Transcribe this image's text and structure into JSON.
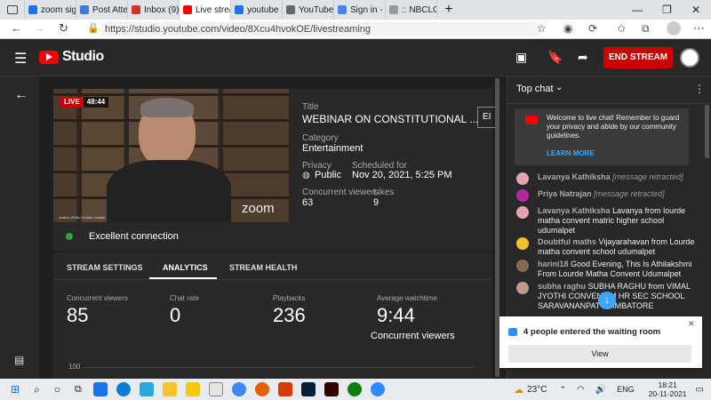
{
  "browser": {
    "tabs": [
      {
        "label": "zoom sign",
        "color": "#1a73e8"
      },
      {
        "label": "Post Attend",
        "color": "#3b7ddd"
      },
      {
        "label": "Inbox (9) -",
        "color": "#d93025"
      },
      {
        "label": "Live stream",
        "color": "#ff0000"
      },
      {
        "label": "youtube stu",
        "color": "#1a73e8"
      },
      {
        "label": "YouTube St",
        "color": "#666666"
      },
      {
        "label": "Sign in - Go",
        "color": "#4285f4"
      },
      {
        "label": ":: NBCLC ::",
        "color": "#999999"
      }
    ],
    "url": "https://studio.youtube.com/video/8Xcu4hvokOE/livestreaming"
  },
  "header": {
    "brand": "Studio",
    "end_stream": "END STREAM"
  },
  "stream": {
    "live_badge": "LIVE",
    "elapsed": "48:44",
    "zoom_watermark": "zoom",
    "caption": "Justice (Retd.) Kurian Joseph",
    "title_label": "Title",
    "title": "WEBINAR ON CONSTITUTIONAL ...",
    "edit_label": "EI",
    "category_label": "Category",
    "category": "Entertainment",
    "privacy_label": "Privacy",
    "privacy": "Public",
    "scheduled_label": "Scheduled for",
    "scheduled": "Nov 20, 2021, 5:25 PM",
    "concurrent_label": "Concurrent viewers",
    "concurrent": "63",
    "likes_label": "Likes",
    "likes": "9",
    "connection": "Excellent connection"
  },
  "tabs": {
    "settings": "STREAM SETTINGS",
    "analytics": "ANALYTICS",
    "health": "STREAM HEALTH"
  },
  "analytics": {
    "m1_label": "Concurrent viewers",
    "m1": "85",
    "m2_label": "Chat rate",
    "m2": "0",
    "m3_label": "Playbacks",
    "m3": "236",
    "m4_label": "Average watchtime",
    "m4": "9:44",
    "chart_title": "Concurrent viewers",
    "axis_top": "100"
  },
  "chat": {
    "title": "Top chat",
    "welcome": "Welcome to live chat! Remember to guard your privacy and abide by our community guidelines.",
    "learn_more": "LEARN MORE",
    "messages": [
      {
        "name": "Lavanya Kathiksha",
        "text": "[message retracted]",
        "color": "#e3a3b3"
      },
      {
        "name": "Priya Natrajan",
        "text": "[message retracted]",
        "color": "#b0279f"
      },
      {
        "name": "Lavanya Kathiksha",
        "text": "Lavanya from lourde matha convent matric higher school udumalpet",
        "color": "#e3a3b3"
      },
      {
        "name": "Doubtful maths",
        "text": "Vijayarahavan from Lourde matha convent school udumalpet",
        "color": "#f0c22e"
      },
      {
        "name": "harini18",
        "text": "Good Evening, This Is Athilakshmi From Lourde Matha Convent Udumalpet",
        "color": "#8a6a55"
      },
      {
        "name": "subha raghu",
        "text": "SUBHA RAGHU from VIMAL JYOTHI CONVENT M    HR SEC SCHOOL SARAVANANPATTY    IMBATORE",
        "color": "#c29a8a"
      }
    ]
  },
  "notification": {
    "text": "4 people entered the waiting room",
    "view": "View"
  },
  "taskbar": {
    "temp": "23°C",
    "lang": "ENG",
    "time": "18:21",
    "date": "20-11-2021"
  }
}
